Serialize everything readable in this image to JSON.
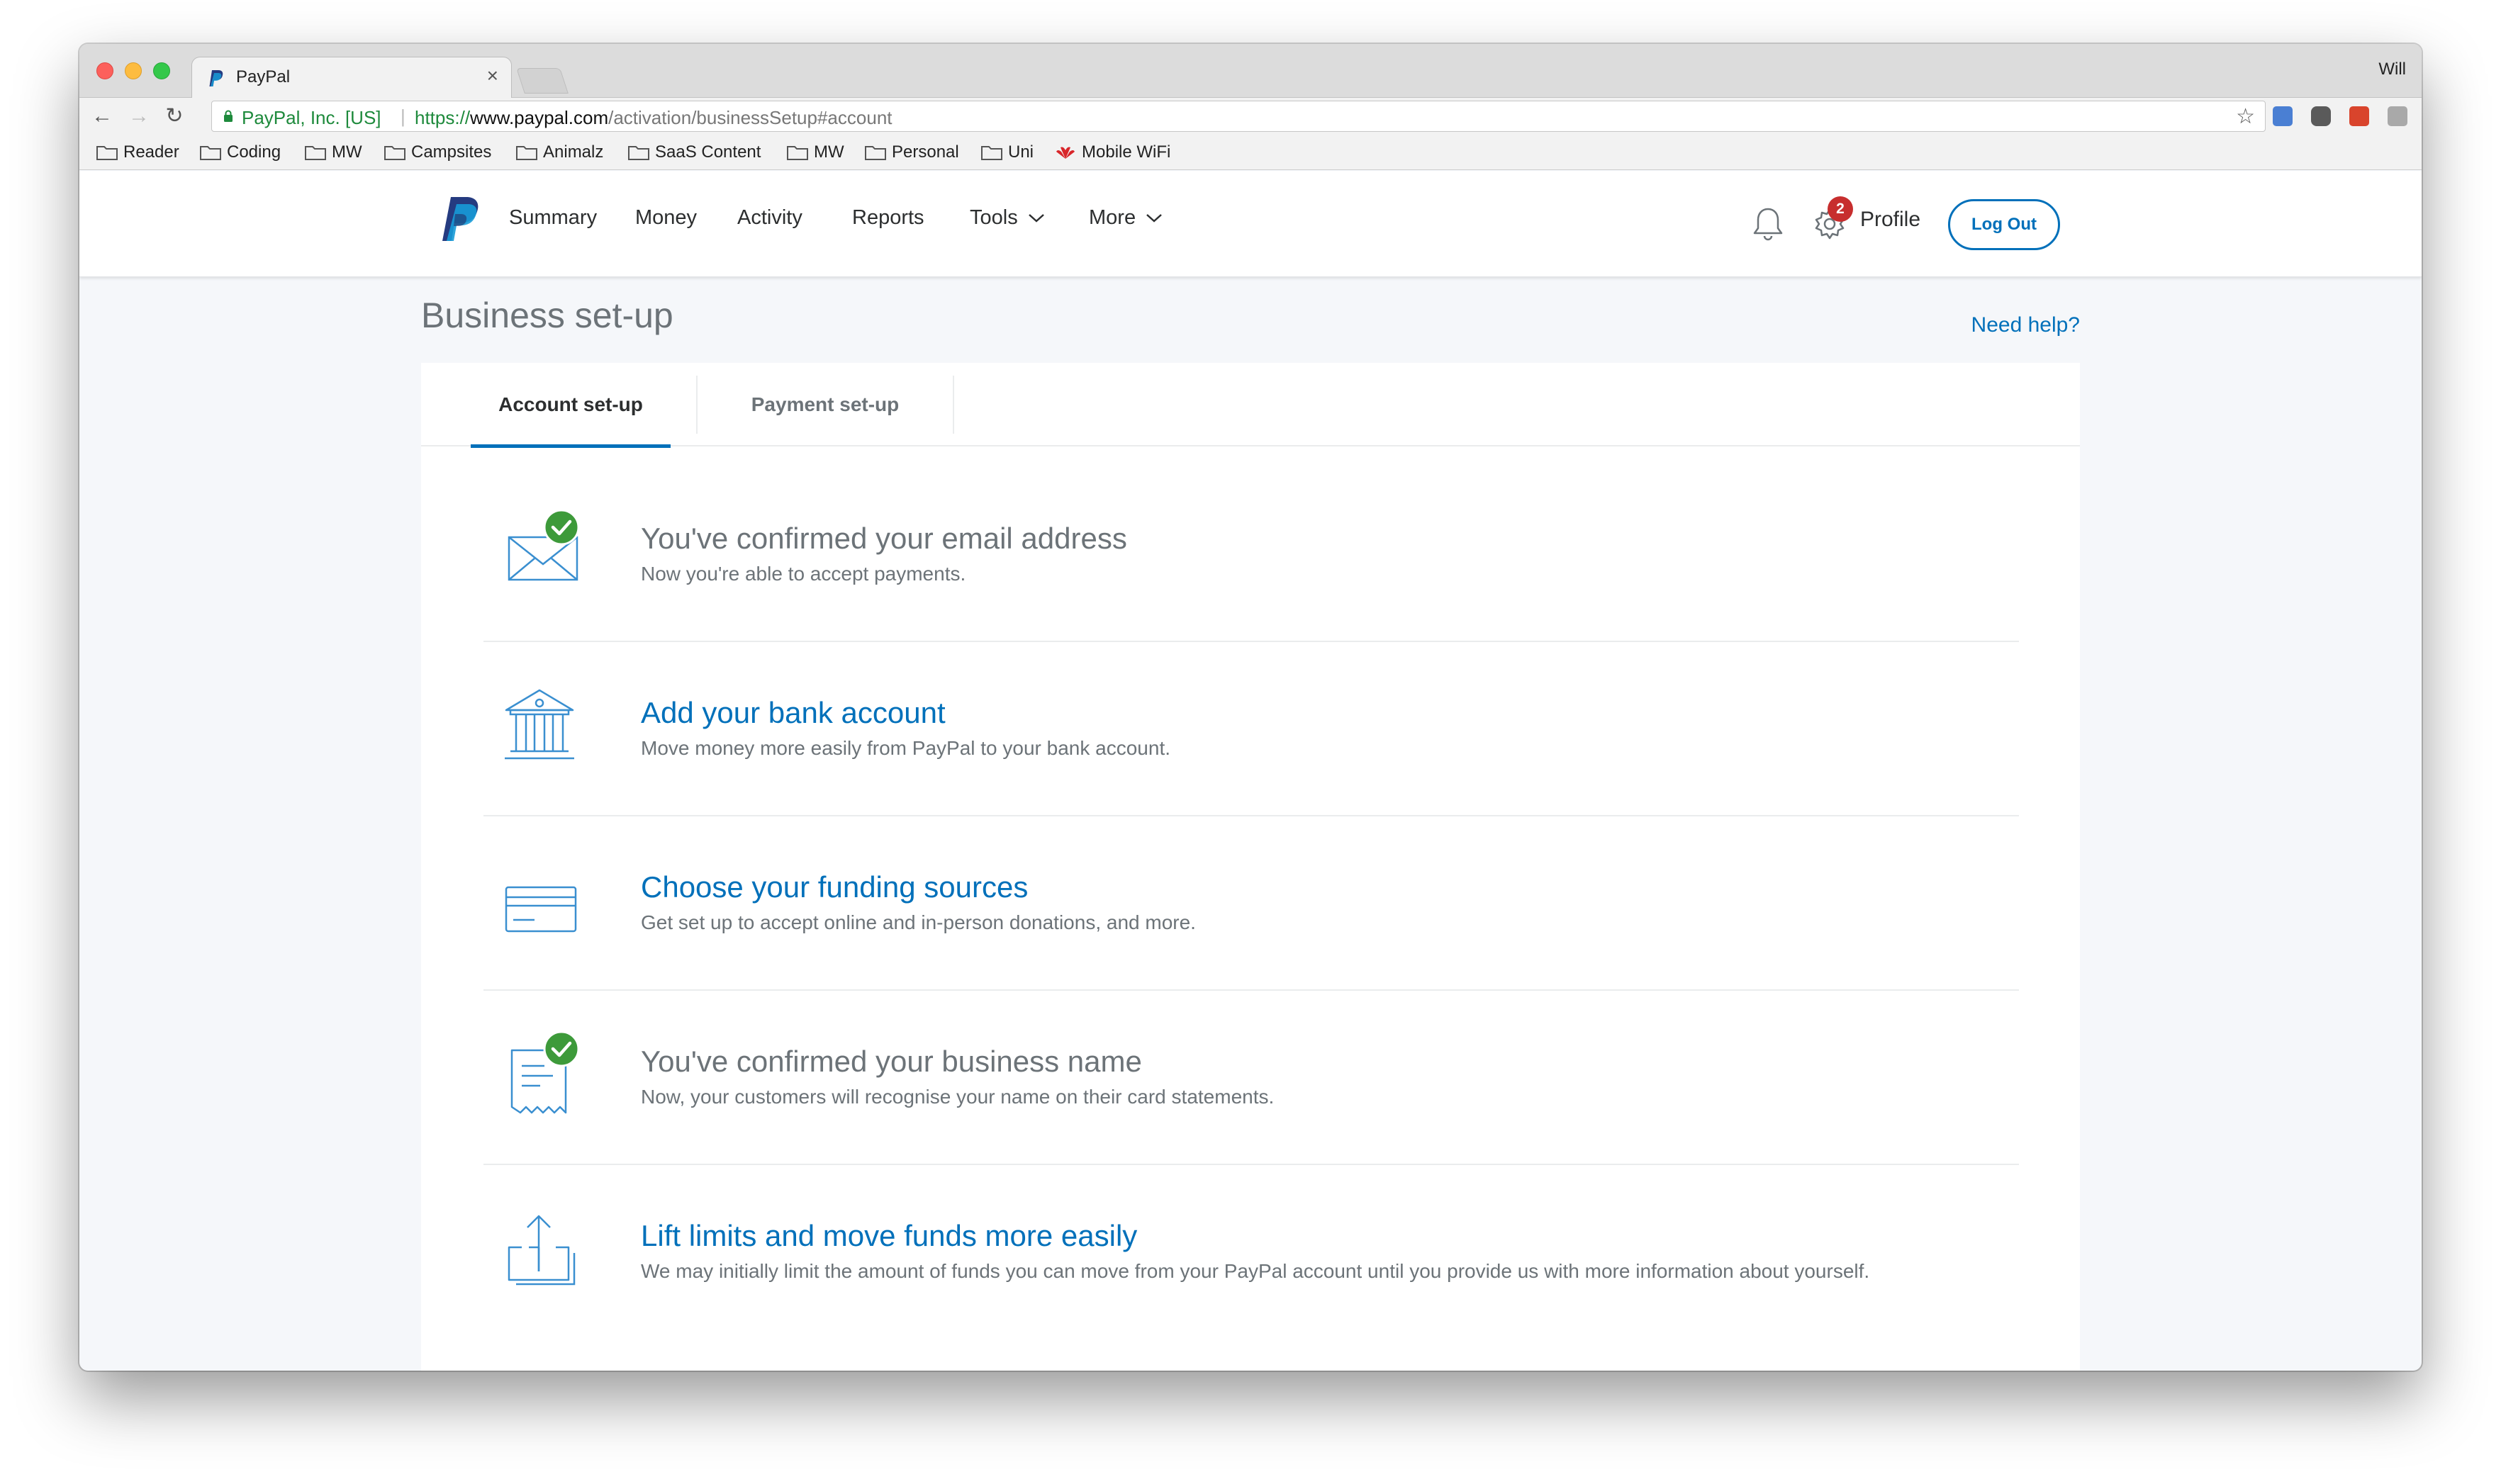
{
  "browser": {
    "tab_title": "PayPal",
    "tab_close": "×",
    "user_name": "Will",
    "ev_name": "PayPal, Inc. [US]",
    "url_scheme": "https://",
    "url_host": "www.paypal.com",
    "url_path": "/activation/businessSetup#account",
    "bookmarks": [
      {
        "label": "Reader"
      },
      {
        "label": "Coding"
      },
      {
        "label": "MW"
      },
      {
        "label": "Campsites"
      },
      {
        "label": "Animalz"
      },
      {
        "label": "SaaS Content"
      },
      {
        "label": "MW"
      },
      {
        "label": "Personal"
      },
      {
        "label": "Uni"
      },
      {
        "label": "Mobile WiFi"
      }
    ]
  },
  "header": {
    "nav": [
      "Summary",
      "Money",
      "Activity",
      "Reports",
      "Tools",
      "More"
    ],
    "notification_count": "2",
    "profile": "Profile",
    "logout": "Log Out"
  },
  "page": {
    "title": "Business set-up",
    "need_help": "Need help?",
    "tabs": [
      {
        "label": "Account set-up",
        "active": true
      },
      {
        "label": "Payment set-up",
        "active": false
      }
    ],
    "steps": [
      {
        "icon": "envelope-check-icon",
        "status": "done",
        "title": "You've confirmed your email address",
        "desc": "Now you're able to accept payments."
      },
      {
        "icon": "bank-icon",
        "status": "todo",
        "title": "Add your bank account",
        "desc": "Move money more easily from PayPal to your bank account."
      },
      {
        "icon": "card-icon",
        "status": "todo",
        "title": "Choose your funding sources",
        "desc": "Get set up to accept online and in-person donations, and more."
      },
      {
        "icon": "receipt-check-icon",
        "status": "done",
        "title": "You've confirmed your business name",
        "desc": "Now, your customers will recognise your name on their card statements."
      },
      {
        "icon": "upload-icon",
        "status": "todo",
        "title": "Lift limits and move funds more easily",
        "desc": "We may initially limit the amount of funds you can move from your PayPal account until you provide us with more information about yourself."
      }
    ]
  },
  "colors": {
    "link_blue": "#0070ba",
    "icon_blue": "#3a8fd0",
    "check_green": "#3d9a3a",
    "badge_red": "#c72e2e",
    "muted_text": "#6c7378"
  }
}
